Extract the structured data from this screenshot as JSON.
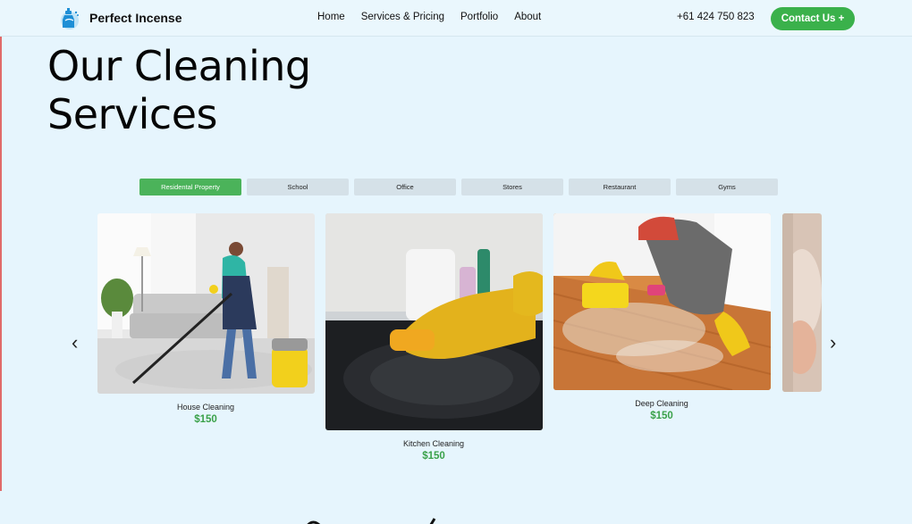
{
  "header": {
    "brand": "Perfect Incense",
    "nav": [
      "Home",
      "Services & Pricing",
      "Portfolio",
      "About"
    ],
    "phone": "+61 424 750 823",
    "contact_label": "Contact Us +"
  },
  "hero": {
    "title_line1": "Our Cleaning",
    "title_line2": "Services"
  },
  "tabs": [
    {
      "label": "Residental Property",
      "active": true
    },
    {
      "label": "School",
      "active": false
    },
    {
      "label": "Office",
      "active": false
    },
    {
      "label": "Stores",
      "active": false
    },
    {
      "label": "Restaurant",
      "active": false
    },
    {
      "label": "Gyms",
      "active": false
    }
  ],
  "carousel": {
    "prev_glyph": "‹",
    "next_glyph": "›",
    "cards": [
      {
        "title": "House Cleaning",
        "price": "$150"
      },
      {
        "title": "Kitchen Cleaning",
        "price": "$150"
      },
      {
        "title": "Deep Cleaning",
        "price": "$150"
      }
    ]
  },
  "colors": {
    "background": "#e6f5fd",
    "accent_green": "#3ab14b",
    "price_green": "#3aa149",
    "tab_inactive": "#d5e1e8"
  },
  "icons": [
    "spray-bottle-logo-icon",
    "chevron-left-icon",
    "chevron-right-icon"
  ]
}
